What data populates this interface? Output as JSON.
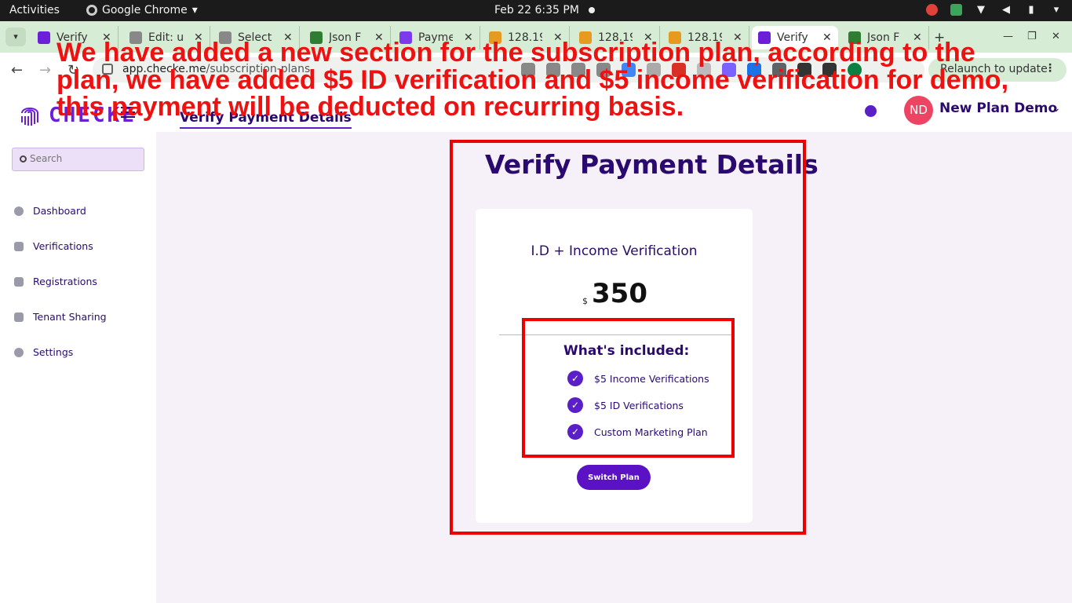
{
  "system_bar": {
    "activities": "Activities",
    "app_name": "Google Chrome",
    "clock": "Feb 22  6:35 PM"
  },
  "tabs": [
    {
      "title": "Verify",
      "favicon_color": "#6b1fd8"
    },
    {
      "title": "Edit: u",
      "favicon_color": "#888888"
    },
    {
      "title": "Select",
      "favicon_color": "#888888"
    },
    {
      "title": "Json F",
      "favicon_color": "#2f7d32"
    },
    {
      "title": "Payme",
      "favicon_color": "#7c3aed"
    },
    {
      "title": "128.19",
      "favicon_color": "#e69a1f"
    },
    {
      "title": "128.19",
      "favicon_color": "#e69a1f"
    },
    {
      "title": "128.19",
      "favicon_color": "#e69a1f"
    },
    {
      "title": "Verify",
      "favicon_color": "#6b1fd8"
    },
    {
      "title": "Json F",
      "favicon_color": "#2f7d32"
    }
  ],
  "toolbar": {
    "url_host": "app.checke.me",
    "url_path": "/subscription-plans",
    "relaunch_label": "Relaunch to update"
  },
  "header": {
    "logo_text": "CHECKE",
    "page_title": "Verify Payment Details",
    "avatar_initials": "ND",
    "user_name": "New Plan Demo"
  },
  "sidebar": {
    "search_placeholder": "Search",
    "items": [
      {
        "label": "Dashboard"
      },
      {
        "label": "Verifications"
      },
      {
        "label": "Registrations"
      },
      {
        "label": "Tenant Sharing"
      },
      {
        "label": "Settings"
      }
    ]
  },
  "main": {
    "title": "Verify Payment Details",
    "plan": {
      "name": "I.D + Income Verification",
      "currency": "$",
      "price": "350",
      "included_title": "What's included:",
      "features": [
        "$5 Income Verifications",
        "$5 ID Verifications",
        "Custom Marketing Plan"
      ],
      "button_label": "Switch Plan"
    }
  },
  "annotation": {
    "note": "We have added a new section for the subscription plan, according to the plan, we have added $5 ID verification and $5 income verification for demo, this payment will be deducted on recurring basis.",
    "color": "#ee0000"
  }
}
